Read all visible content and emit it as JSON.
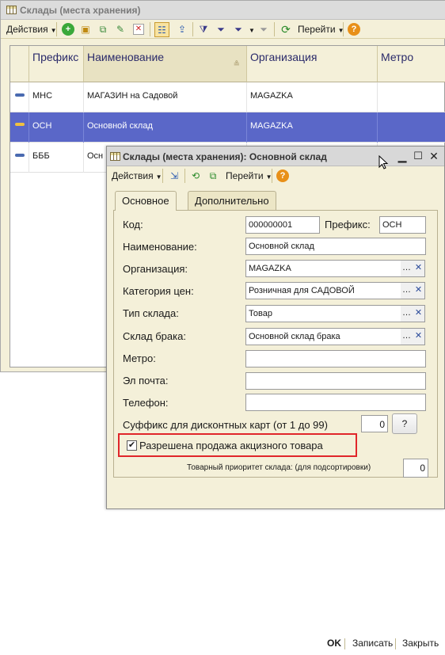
{
  "main_window": {
    "title": "Склады (места хранения)",
    "toolbar": {
      "actions_label": "Действия",
      "goto_label": "Перейти"
    },
    "grid": {
      "columns": [
        "Префикс",
        "Наименование",
        "Организация",
        "Метро"
      ],
      "sort_indicator": "≗",
      "rows": [
        {
          "prefix": "МНС",
          "name": "МАГАЗИН на Садовой",
          "org": "MAGAZKA",
          "metro": "",
          "selected": false
        },
        {
          "prefix": "ОСН",
          "name": "Основной склад",
          "org": "MAGAZKA",
          "metro": "",
          "selected": true
        },
        {
          "prefix": "БББ",
          "name": "Осн",
          "org": "",
          "metro": "",
          "selected": false
        }
      ]
    }
  },
  "dialog": {
    "title": "Склады (места хранения): Основной склад",
    "toolbar": {
      "actions_label": "Действия",
      "goto_label": "Перейти"
    },
    "tabs": [
      "Основное",
      "Дополнительно"
    ],
    "fields": {
      "code_label": "Код:",
      "code_value": "000000001",
      "prefix_label": "Префикс:",
      "prefix_value": "ОСН",
      "name_label": "Наименование:",
      "name_value": "Основной склад",
      "org_label": "Организация:",
      "org_value": "MAGAZKA",
      "price_cat_label": "Категория цен:",
      "price_cat_value": "Розничная для САДОВОЙ",
      "type_label": "Тип склада:",
      "type_value": "Товар",
      "defect_label": "Склад брака:",
      "defect_value": "Основной склад брака",
      "metro_label": "Метро:",
      "metro_value": "",
      "email_label": "Эл почта:",
      "email_value": "",
      "phone_label": "Телефон:",
      "phone_value": "",
      "suffix_label": "Суффикс для дисконтных карт (от 1 до 99)",
      "suffix_value": "0",
      "suffix_help": "?",
      "excise_label": "Разрешена продажа акцизного товара",
      "excise_checked": true,
      "priority_label": "Товарный приоритет склада: (для подсортировки)",
      "priority_value": "0"
    },
    "footer": {
      "ok": "OK",
      "save": "Записать",
      "close": "Закрыть"
    }
  },
  "colors": {
    "selected_row": "#5a67c8",
    "highlight_frame": "#e0262a",
    "panel_bg": "#f4f0d9"
  }
}
